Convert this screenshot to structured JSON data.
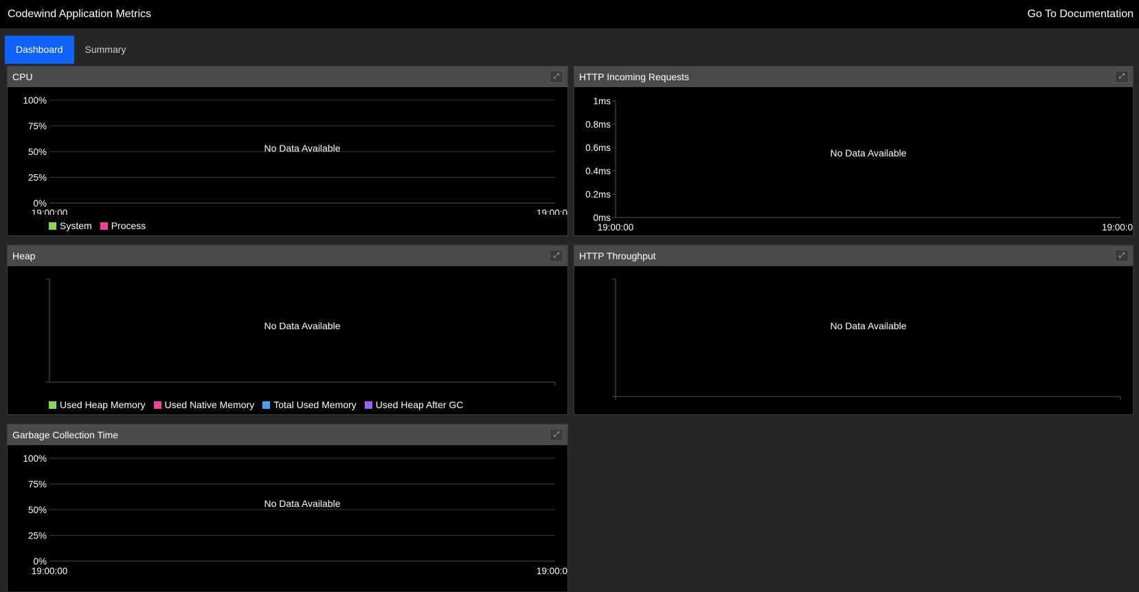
{
  "header": {
    "app_title": "Codewind Application Metrics",
    "doc_link": "Go To Documentation"
  },
  "tabs": [
    {
      "label": "Dashboard",
      "active": true
    },
    {
      "label": "Summary",
      "active": false
    }
  ],
  "panels": {
    "cpu": {
      "title": "CPU",
      "no_data": "No Data Available",
      "y_ticks": [
        "100%",
        "75%",
        "50%",
        "25%",
        "0%"
      ],
      "x_ticks": [
        "19:00:00",
        "19:00:0"
      ],
      "legend": [
        {
          "label": "System",
          "color": "#8bd657"
        },
        {
          "label": "Process",
          "color": "#f3449a"
        }
      ]
    },
    "http_in": {
      "title": "HTTP Incoming Requests",
      "no_data": "No Data Available",
      "y_ticks": [
        "1ms",
        "0.8ms",
        "0.6ms",
        "0.4ms",
        "0.2ms",
        "0ms"
      ],
      "x_ticks": [
        "19:00:00",
        "19:00:0"
      ]
    },
    "heap": {
      "title": "Heap",
      "no_data": "No Data Available",
      "legend": [
        {
          "label": "Used Heap Memory",
          "color": "#8bd657"
        },
        {
          "label": "Used Native Memory",
          "color": "#f3449a"
        },
        {
          "label": "Total Used Memory",
          "color": "#4aa3f0"
        },
        {
          "label": "Used Heap After GC",
          "color": "#9466f0"
        }
      ]
    },
    "http_throughput": {
      "title": "HTTP Throughput",
      "no_data": "No Data Available"
    },
    "gc": {
      "title": "Garbage Collection Time",
      "no_data": "No Data Available",
      "y_ticks": [
        "100%",
        "75%",
        "50%",
        "25%",
        "0%"
      ],
      "x_ticks": [
        "19:00:00",
        "19:00:0"
      ]
    }
  },
  "icons": {
    "expand": "expand-icon"
  },
  "colors": {
    "accent": "#0f62fe",
    "panel_header": "#4a4a4a",
    "background": "#262626"
  }
}
